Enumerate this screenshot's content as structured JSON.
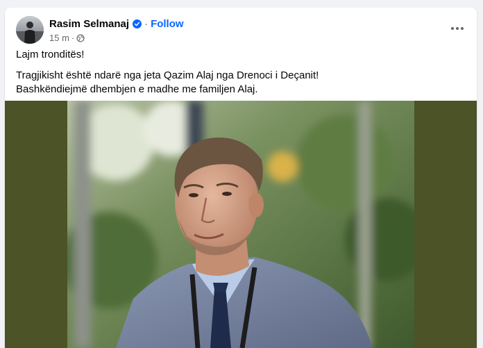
{
  "post": {
    "author": {
      "name": "Rasim Selmanaj",
      "verified_icon": "verified-badge-icon",
      "follow_label": "Follow"
    },
    "meta": {
      "timestamp": "15 m",
      "separator": "·",
      "audience_icon": "globe-icon"
    },
    "more_icon": "more-options-icon",
    "text": {
      "line_1": "Lajm tronditës!",
      "line_2": "Tragjikisht është ndarë nga jeta Qazim Alaj nga Drenoci i Deçanit!",
      "line_3": "Bashkëndiejmë dhembjen e madhe me familjen Alaj."
    },
    "media": {
      "type": "photo",
      "subject": "man in grey suit with lanyard, outdoor blurred greenery"
    }
  },
  "colors": {
    "accent": "#0866ff",
    "text_primary": "#050505",
    "text_secondary": "#65676b",
    "media_letterbox": "#4b5327",
    "page_background": "#f0f2f5"
  }
}
